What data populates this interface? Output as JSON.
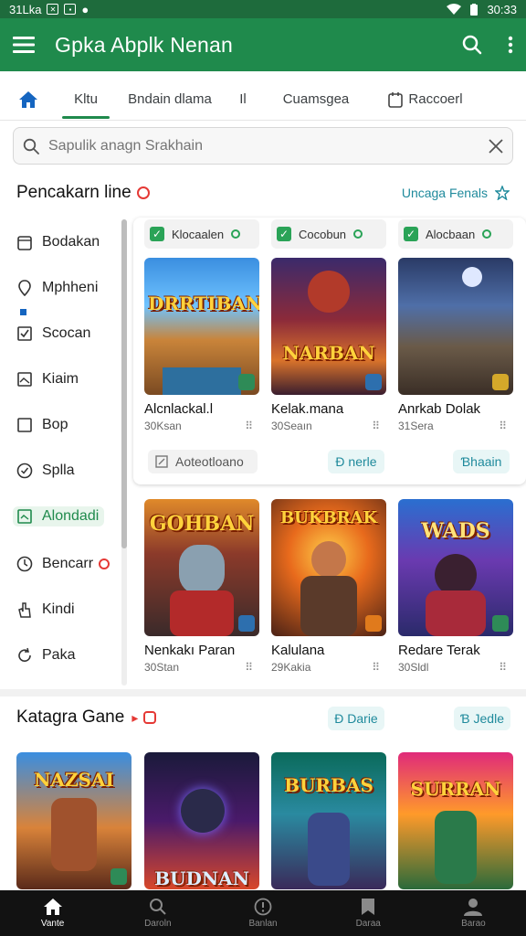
{
  "status_bar": {
    "left_text": "31Lka",
    "time": "30:33"
  },
  "app_bar": {
    "title": "Gpka Abplk Nenan"
  },
  "tabs": [
    {
      "label": "Kltu"
    },
    {
      "label": "Bndain dlama"
    },
    {
      "label": "Il"
    },
    {
      "label": "Cuamsgea"
    },
    {
      "label": "Raccoerl"
    }
  ],
  "search": {
    "placeholder": "Sapulik anagn Srakhain"
  },
  "section1": {
    "title": "Pencakarn line",
    "link": "Uncaga Fenals"
  },
  "sidebar": {
    "items": [
      {
        "label": "Bodakan",
        "icon": "calendar-icon"
      },
      {
        "label": "Mphheni",
        "icon": "pin-icon"
      },
      {
        "label": "Scocan",
        "icon": "checkbox-icon"
      },
      {
        "label": "Kiaim",
        "icon": "image-icon"
      },
      {
        "label": "Bop",
        "icon": "square-icon"
      },
      {
        "label": "Splla",
        "icon": "circle-check-icon"
      },
      {
        "label": "Alondadi",
        "icon": "picture-icon"
      },
      {
        "label": "Bencarr",
        "icon": "clock-icon"
      },
      {
        "label": "Kindi",
        "icon": "hand-icon"
      },
      {
        "label": "Paka",
        "icon": "refresh-icon"
      }
    ]
  },
  "filter_chips": [
    {
      "label": "Klocaalen"
    },
    {
      "label": "Cocobun"
    },
    {
      "label": "Alocbaan"
    }
  ],
  "row1": [
    {
      "art_label": "DRRTIBAN",
      "name": "Alcnlackal.l",
      "meta": "30Ksan"
    },
    {
      "art_label": "NARBAN",
      "name": "Kelak.mana",
      "meta": "30Seaın"
    },
    {
      "art_label": "",
      "name": "Anrkab Dolak",
      "meta": "31Sera"
    }
  ],
  "panel_footer": {
    "left": "Aoteotloano",
    "mid": "Ɖ nerle",
    "right": "Ɓhaain"
  },
  "row2": [
    {
      "art_label": "GOHBAN",
      "name": "Nenkakı Paran",
      "meta": "30Stan"
    },
    {
      "art_label": "BUKBRAK",
      "name": "Kalulana",
      "meta": "29Kakia"
    },
    {
      "art_label": "WADS",
      "name": "Redare Terak",
      "meta": "30Sldl"
    }
  ],
  "section2": {
    "title": "Katagra Gane",
    "btn1": "Ɖ Darie",
    "btn2": "Ɓ Jedle"
  },
  "row3": [
    {
      "art_label": "NAZSAI"
    },
    {
      "art_label": "BUDNAN"
    },
    {
      "art_label": "BURBAS"
    },
    {
      "art_label": "SURRAN"
    }
  ],
  "bottom_nav": [
    {
      "label": "Vante",
      "icon": "home-icon"
    },
    {
      "label": "Daroln",
      "icon": "search-icon"
    },
    {
      "label": "Banlan",
      "icon": "info-icon"
    },
    {
      "label": "Daraa",
      "icon": "bookmark-icon"
    },
    {
      "label": "Barao",
      "icon": "person-icon"
    }
  ],
  "colors": {
    "primary": "#1f8a4c",
    "status": "#1e6b3c",
    "accent": "#1f8a9c",
    "nav_bg": "#121212"
  }
}
